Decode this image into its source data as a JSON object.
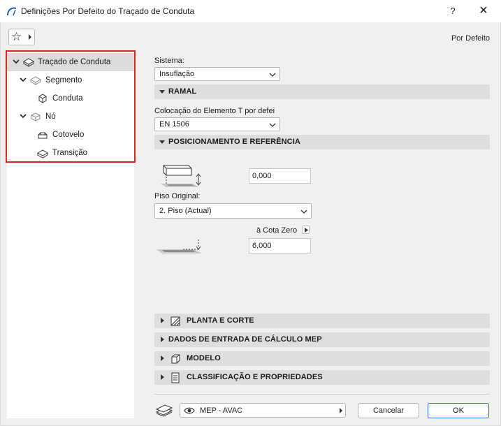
{
  "window": {
    "title": "Definições Por Defeito do Traçado de Conduta",
    "help_label": "?",
    "close_label": "✕"
  },
  "header": {
    "favorites_icon": "star-icon",
    "default_label": "Por Defeito"
  },
  "tree": {
    "items": [
      {
        "label": "Traçado de Conduta",
        "icon": "duct-route-icon",
        "expanded": true,
        "selected": true
      },
      {
        "label": "Segmento",
        "icon": "segment-icon",
        "expanded": true
      },
      {
        "label": "Conduta",
        "icon": "duct-icon"
      },
      {
        "label": "Nó",
        "icon": "node-icon",
        "expanded": true
      },
      {
        "label": "Cotovelo",
        "icon": "elbow-icon"
      },
      {
        "label": "Transição",
        "icon": "transition-icon"
      }
    ]
  },
  "system": {
    "label": "Sistema:",
    "value": "Insuflação"
  },
  "sections": {
    "ramal": "RAMAL",
    "positioning": "POSICIONAMENTO E REFERÊNCIA",
    "plan_section": "PLANTA E CORTE",
    "mep_calc": "DADOS DE ENTRADA DE CÁLCULO MEP",
    "model": "MODELO",
    "classification": "CLASSIFICAÇÃO E PROPRIEDADES"
  },
  "ramal": {
    "tee_label": "Colocação do Elemento T por defei",
    "tee_value": "EN 1506"
  },
  "positioning": {
    "offset_value": "0,000",
    "home_story_label": "Piso Original:",
    "home_story_value": "2. Piso (Actual)",
    "cota_zero_label": "à Cota Zero",
    "elevation_value": "6,000"
  },
  "footer": {
    "layer_icon": "layer-icon",
    "layer_value": "MEP - AVAC",
    "cancel_label": "Cancelar",
    "ok_label": "OK"
  },
  "colors": {
    "highlight": "#d9262b",
    "primary_border": "#2b6fd6",
    "section_bg": "#dedede"
  }
}
